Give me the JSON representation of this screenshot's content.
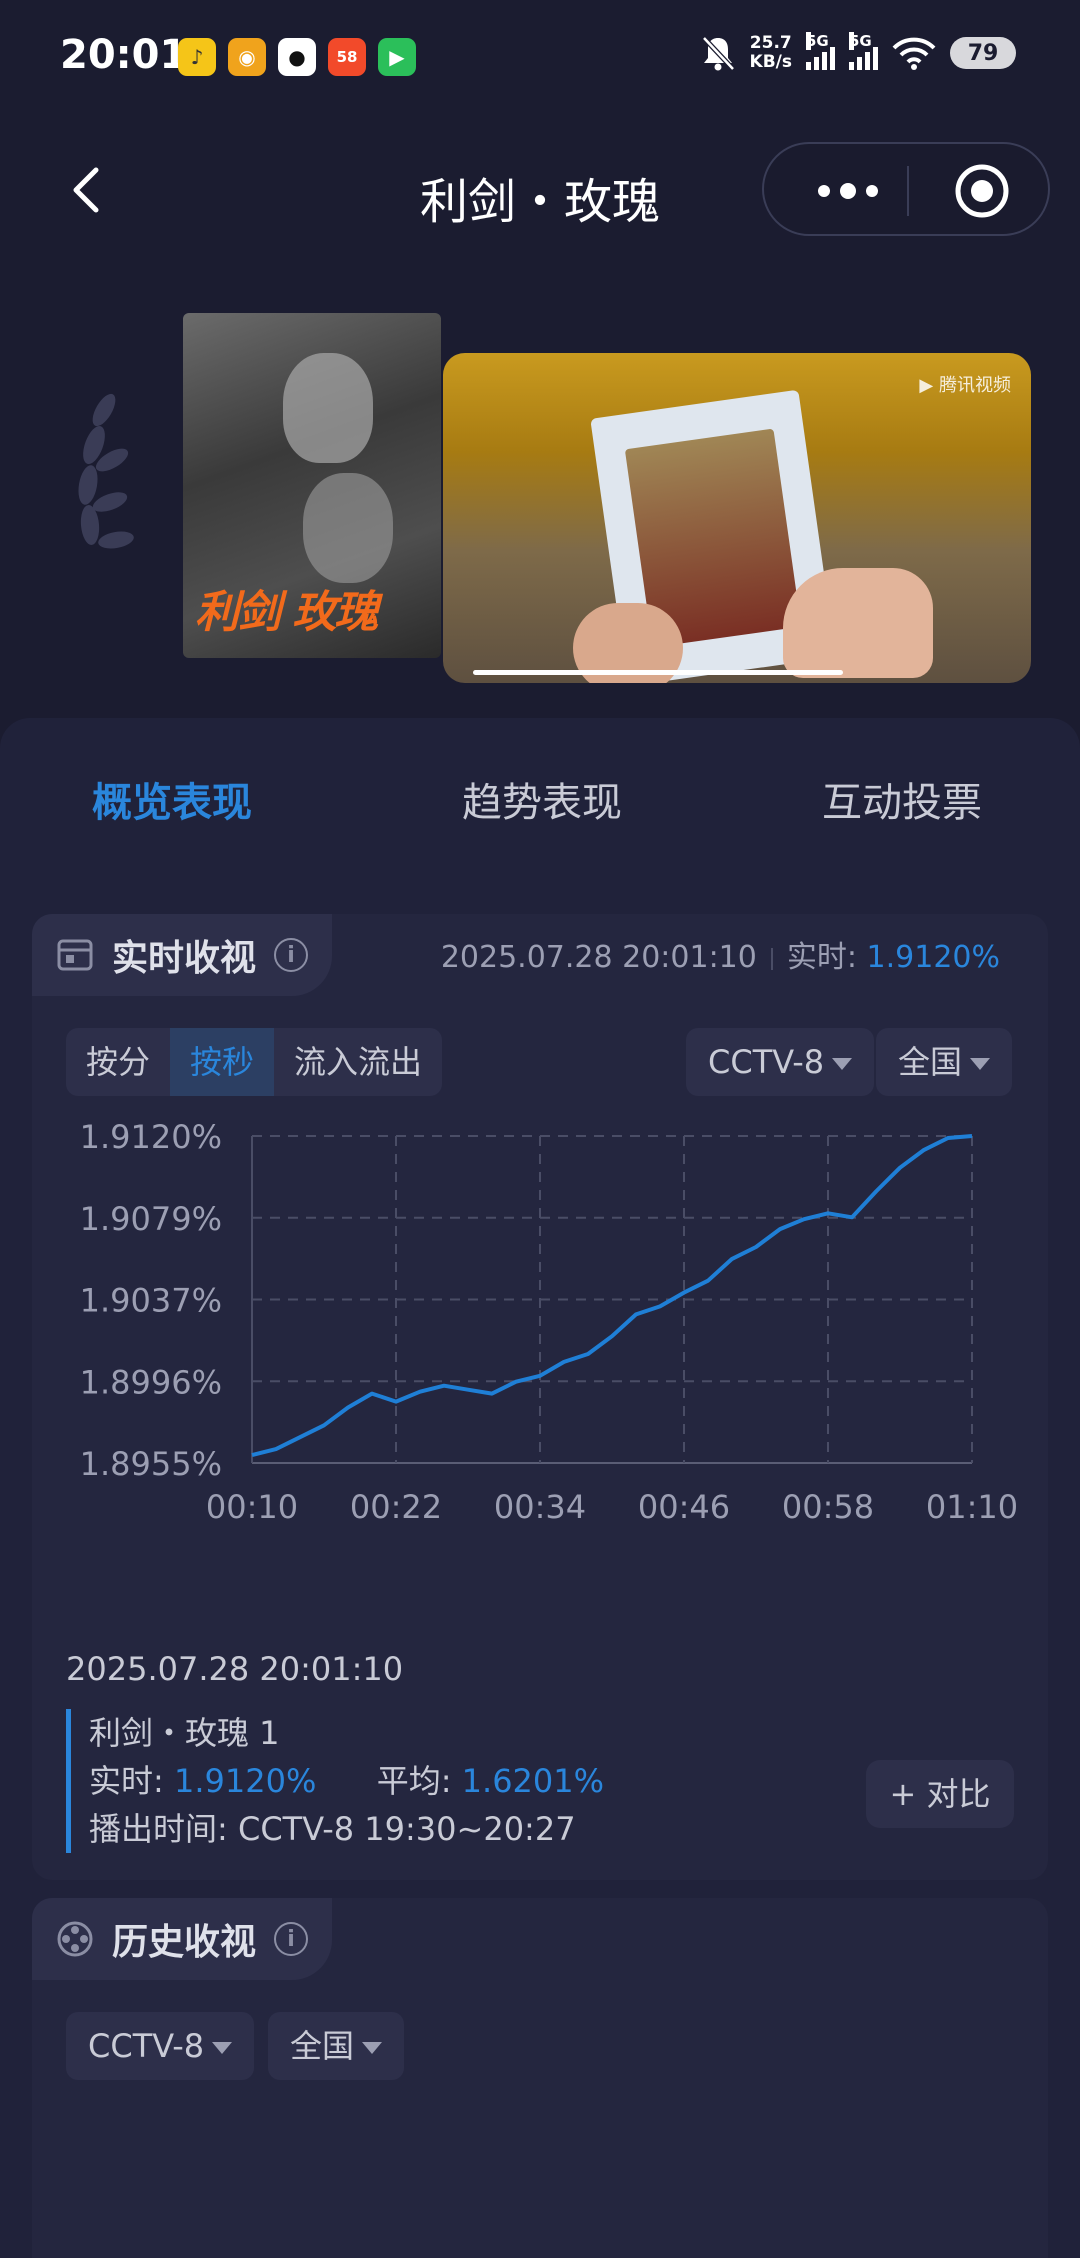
{
  "status_bar": {
    "time": "20:01",
    "net_speed_value": "25.7",
    "net_speed_unit": "KB/s",
    "signal1_label": "5G",
    "signal2_label": "5G",
    "battery": "79"
  },
  "nav": {
    "title": "利剑・玫瑰"
  },
  "poster": {
    "title_text": "利剑 玫瑰"
  },
  "video": {
    "watermark": "腾讯视频",
    "progress": 0.63
  },
  "tabs": [
    {
      "label": "概览表现",
      "active": true
    },
    {
      "label": "趋势表现",
      "active": false
    },
    {
      "label": "互动投票",
      "active": false
    }
  ],
  "realtime": {
    "title": "实时收视",
    "info": "i",
    "timestamp": "2025.07.28 20:01:10",
    "rt_label": "实时:",
    "rt_value": "1.9120%",
    "modes": [
      "按分",
      "按秒",
      "流入流出"
    ],
    "channel": "CCTV-8",
    "region": "全国"
  },
  "chart_data": {
    "type": "line",
    "ylim": [
      1.8955,
      1.912
    ],
    "yticks": [
      "1.9120%",
      "1.9079%",
      "1.9037%",
      "1.8996%",
      "1.8955%"
    ],
    "xticks": [
      "00:10",
      "00:22",
      "00:34",
      "00:46",
      "00:58",
      "01:10"
    ],
    "x": [
      10,
      12,
      14,
      16,
      18,
      20,
      22,
      24,
      26,
      28,
      30,
      32,
      34,
      36,
      38,
      40,
      42,
      44,
      46,
      48,
      50,
      52,
      54,
      56,
      58,
      60,
      62,
      64,
      66,
      68,
      70
    ],
    "y": [
      1.8959,
      1.8962,
      1.8968,
      1.8974,
      1.8983,
      1.899,
      1.8986,
      1.8991,
      1.8994,
      1.8992,
      1.899,
      1.8996,
      1.8999,
      1.9006,
      1.901,
      1.9019,
      1.903,
      1.9034,
      1.9041,
      1.9047,
      1.9058,
      1.9064,
      1.9073,
      1.9078,
      1.9081,
      1.9079,
      1.9092,
      1.9104,
      1.9113,
      1.9119,
      1.912
    ],
    "color": "#1f7fd6"
  },
  "detail": {
    "date": "2025.07.28 20:01:10",
    "program": "利剑・玫瑰 1",
    "rt_label": "实时:",
    "rt_value": "1.9120%",
    "avg_label": "平均:",
    "avg_value": "1.6201%",
    "airtime_label": "播出时间:",
    "airtime_value": "CCTV-8 19:30~20:27",
    "compare": "+ 对比"
  },
  "history": {
    "title": "历史收视",
    "info": "i",
    "channel": "CCTV-8",
    "region": "全国"
  },
  "colors": {
    "accent": "#2a86dc",
    "background": "#1b1c30",
    "panel": "#20223a"
  }
}
